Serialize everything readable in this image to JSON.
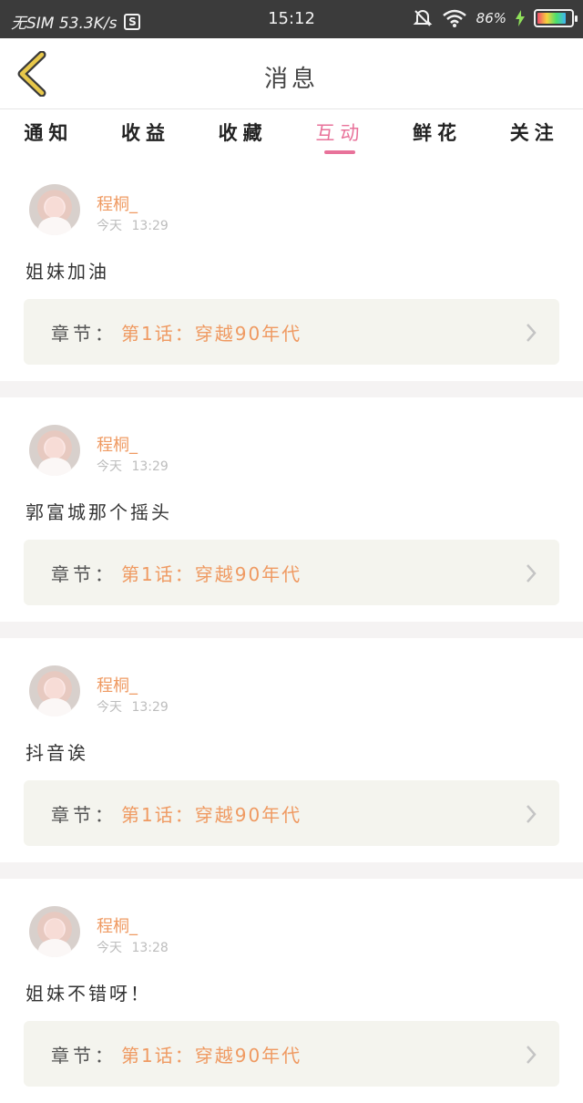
{
  "status_bar": {
    "carrier": "无SIM 53.3K/s",
    "time": "15:12",
    "battery": "86%"
  },
  "header": {
    "title": "消息"
  },
  "tabs": [
    {
      "label": "通知"
    },
    {
      "label": "收益"
    },
    {
      "label": "收藏"
    },
    {
      "label": "互动",
      "active": true
    },
    {
      "label": "鲜花"
    },
    {
      "label": "关注"
    }
  ],
  "messages": [
    {
      "user": "程桐_",
      "time": "今天 13:29",
      "content": "姐妹加油",
      "chapter_label": "章节：",
      "chapter_title": "第1话：穿越90年代"
    },
    {
      "user": "程桐_",
      "time": "今天 13:29",
      "content": "郭富城那个摇头",
      "chapter_label": "章节：",
      "chapter_title": "第1话：穿越90年代"
    },
    {
      "user": "程桐_",
      "time": "今天 13:29",
      "content": "抖音诶",
      "chapter_label": "章节：",
      "chapter_title": "第1话：穿越90年代"
    },
    {
      "user": "程桐_",
      "time": "今天 13:28",
      "content": "姐妹不错呀！",
      "chapter_label": "章节：",
      "chapter_title": "第1话：穿越90年代"
    }
  ],
  "colors": {
    "accent": "#e8729a",
    "username": "#ef9a62",
    "back_arrow": "#e8c84a"
  }
}
